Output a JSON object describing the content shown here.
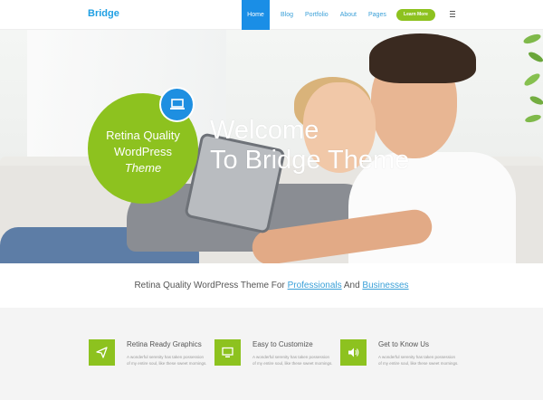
{
  "header": {
    "logo": "Bridge",
    "nav": [
      {
        "label": "Home",
        "active": true
      },
      {
        "label": "Blog"
      },
      {
        "label": "Portfolio"
      },
      {
        "label": "About"
      },
      {
        "label": "Pages"
      }
    ],
    "cta_label": "Learn More",
    "menu_icon": "hamburger-icon"
  },
  "hero": {
    "badge_line1": "Retina Quality",
    "badge_line2": "WordPress",
    "badge_line3": "Theme",
    "badge_icon": "laptop-icon",
    "title_line1": "Welcome",
    "title_line2": "To Bridge Theme"
  },
  "tagline": {
    "prefix": "Retina Quality WordPress Theme For ",
    "link1": "Professionals",
    "middle": " And ",
    "link2": "Businesses"
  },
  "features": [
    {
      "icon": "paper-plane-icon",
      "title": "Retina Ready Graphics",
      "desc": "A wonderful serenity has taken possession of my entire soul, like these sweet mornings."
    },
    {
      "icon": "monitor-icon",
      "title": "Easy to Customize",
      "desc": "A wonderful serenity has taken possession of my entire soul, like these sweet mornings."
    },
    {
      "icon": "speaker-icon",
      "title": "Get to Know Us",
      "desc": "A wonderful serenity has taken possession of my entire soul, like these sweet mornings."
    }
  ],
  "colors": {
    "accent_green": "#8dc21f",
    "accent_blue": "#1e8fe1"
  }
}
